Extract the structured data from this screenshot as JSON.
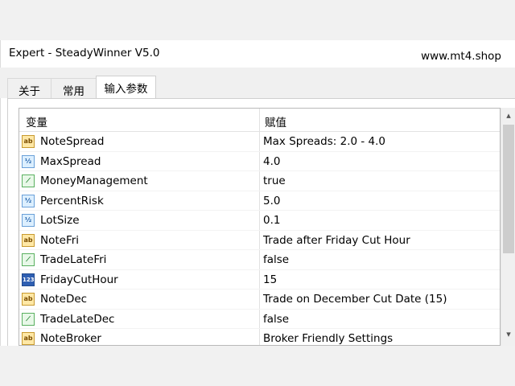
{
  "window": {
    "title": "Expert - SteadyWinner V5.0",
    "site": "www.mt4.shop"
  },
  "tabs": [
    {
      "label": "关于"
    },
    {
      "label": "常用"
    },
    {
      "label": "输入参数",
      "active": true
    }
  ],
  "grid": {
    "headers": {
      "variable": "变量",
      "value": "赋值"
    },
    "rows": [
      {
        "icon": "ab",
        "name": "NoteSpread",
        "value": "Max Spreads: 2.0 - 4.0"
      },
      {
        "icon": "v2",
        "name": "MaxSpread",
        "value": "4.0"
      },
      {
        "icon": "bool",
        "name": "MoneyManagement",
        "value": "true"
      },
      {
        "icon": "v2",
        "name": "PercentRisk",
        "value": "5.0"
      },
      {
        "icon": "v2",
        "name": "LotSize",
        "value": "0.1"
      },
      {
        "icon": "ab",
        "name": "NoteFri",
        "value": "Trade after Friday Cut Hour"
      },
      {
        "icon": "bool",
        "name": "TradeLateFri",
        "value": "false"
      },
      {
        "icon": "123",
        "name": "FridayCutHour",
        "value": "15"
      },
      {
        "icon": "ab",
        "name": "NoteDec",
        "value": "Trade on December Cut Date (15)"
      },
      {
        "icon": "bool",
        "name": "TradeLateDec",
        "value": "false"
      },
      {
        "icon": "ab",
        "name": "NoteBroker",
        "value": "Broker Friendly Settings"
      }
    ]
  },
  "icons": {
    "ab": {
      "glyph": "ab",
      "semantic": "string-type-icon"
    },
    "v2": {
      "glyph": "½",
      "semantic": "double-type-icon"
    },
    "bool": {
      "glyph": "⟋",
      "semantic": "bool-type-icon"
    },
    "123": {
      "glyph": "123",
      "semantic": "int-type-icon"
    }
  },
  "scrollbar": {
    "up": "▴",
    "down": "▾"
  }
}
